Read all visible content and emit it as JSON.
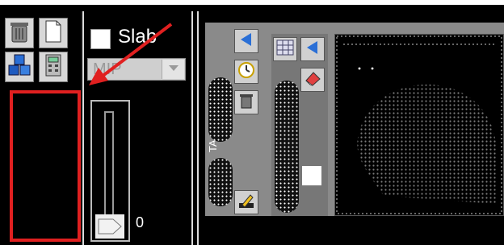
{
  "left_toolbar": {
    "buttons": [
      {
        "icon": "trash-icon"
      },
      {
        "icon": "document-icon"
      },
      {
        "icon": "cubes-icon"
      },
      {
        "icon": "calculator-icon"
      }
    ],
    "highlight_color": "#e02020"
  },
  "middle_panel": {
    "slab_label": "Slab",
    "combo_value": "MIP",
    "slider_value": "0",
    "arrow_color": "#e02020"
  },
  "right_panel": {
    "side_label": "TA... K...E",
    "tool_icons": [
      "play-left-icon",
      "clock-icon",
      "delete-icon",
      "pencil-icon"
    ],
    "viewer_icons": [
      "grid-icon",
      "play-left-icon",
      "eraser-icon"
    ]
  }
}
